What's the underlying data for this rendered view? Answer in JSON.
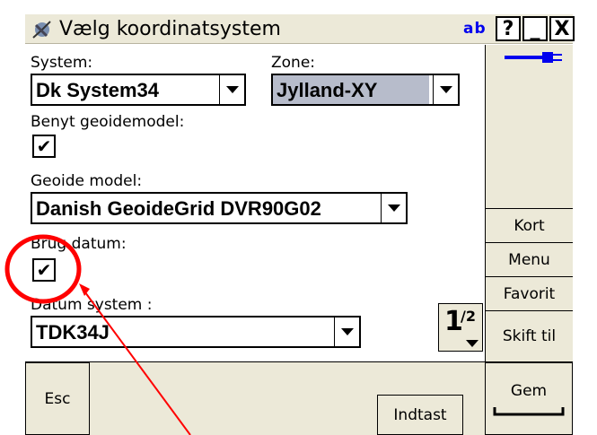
{
  "window": {
    "title": "Vælg koordinatsystem",
    "input_mode": "ab",
    "help": "?",
    "minimize": "_",
    "close": "X"
  },
  "form": {
    "system_label": "System:",
    "system_value": "Dk System34",
    "zone_label": "Zone:",
    "zone_value": "Jylland-XY",
    "geoid_checkbox_label": "Benyt geoidemodel:",
    "geoid_model_label": "Geoide model:",
    "geoid_model_value": "Danish GeoideGrid DVR90G02",
    "datum_checkbox_label": "Brug datum:",
    "datum_system_label": "Datum system :",
    "datum_system_value": "TDK34J",
    "checkmark": "✔"
  },
  "page_indicator": {
    "current": "1",
    "total": "/2"
  },
  "sidebar": {
    "kort": "Kort",
    "menu": "Menu",
    "favorit": "Favorit",
    "skift": "Skift til"
  },
  "footer": {
    "esc": "Esc",
    "indtast": "Indtast",
    "gem": "Gem"
  },
  "colors": {
    "panel": "#ece9d8",
    "accent": "#0000ee",
    "annotation": "#ff0000",
    "zone_bg": "#b7bccb"
  }
}
